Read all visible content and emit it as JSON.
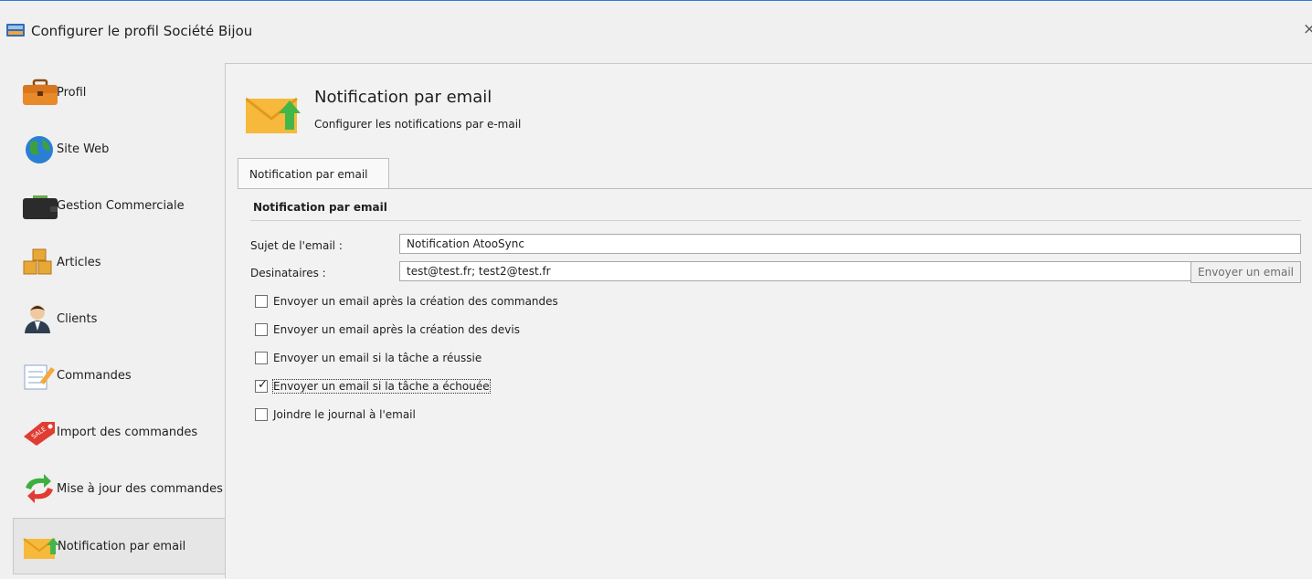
{
  "window": {
    "title": "Configurer le profil Société Bijou",
    "close_glyph": "×"
  },
  "sidebar": {
    "items": [
      {
        "label": "Profil",
        "icon": "briefcase-icon"
      },
      {
        "label": "Site Web",
        "icon": "globe-icon"
      },
      {
        "label": "Gestion Commerciale",
        "icon": "wallet-icon"
      },
      {
        "label": "Articles",
        "icon": "boxes-icon"
      },
      {
        "label": "Clients",
        "icon": "user-icon"
      },
      {
        "label": "Commandes",
        "icon": "order-sheet-icon"
      },
      {
        "label": "Import des commandes",
        "icon": "sale-tag-icon"
      },
      {
        "label": "Mise à jour des commandes",
        "icon": "refresh-arrows-icon"
      },
      {
        "label": "Notification par email",
        "icon": "email-notification-icon",
        "selected": true
      }
    ]
  },
  "header": {
    "title": "Notification par email",
    "subtitle": "Configurer les notifications par e-mail"
  },
  "tabs": [
    {
      "label": "Notification par email",
      "active": true
    }
  ],
  "form": {
    "section_title": "Notification par email",
    "subject_label": "Sujet de l'email :",
    "subject_value": "Notification AtooSync",
    "recipients_label": "Desinataires :",
    "recipients_value": "test@test.fr; test2@test.fr",
    "send_button": "Envoyer un email",
    "checkboxes": [
      {
        "label": "Envoyer un email après la création des commandes",
        "checked": false
      },
      {
        "label": "Envoyer un email après la création des devis",
        "checked": false
      },
      {
        "label": "Envoyer un email si la tâche a réussie",
        "checked": false
      },
      {
        "label": "Envoyer un email si la tâche a échouée",
        "checked": true
      },
      {
        "label": "Joindre le journal à l'email",
        "checked": false
      }
    ],
    "check_glyph": "✓"
  },
  "colors": {
    "accent_line": "#2b7cd3",
    "envelope": "#f6b93b",
    "arrow_green": "#43b649"
  }
}
